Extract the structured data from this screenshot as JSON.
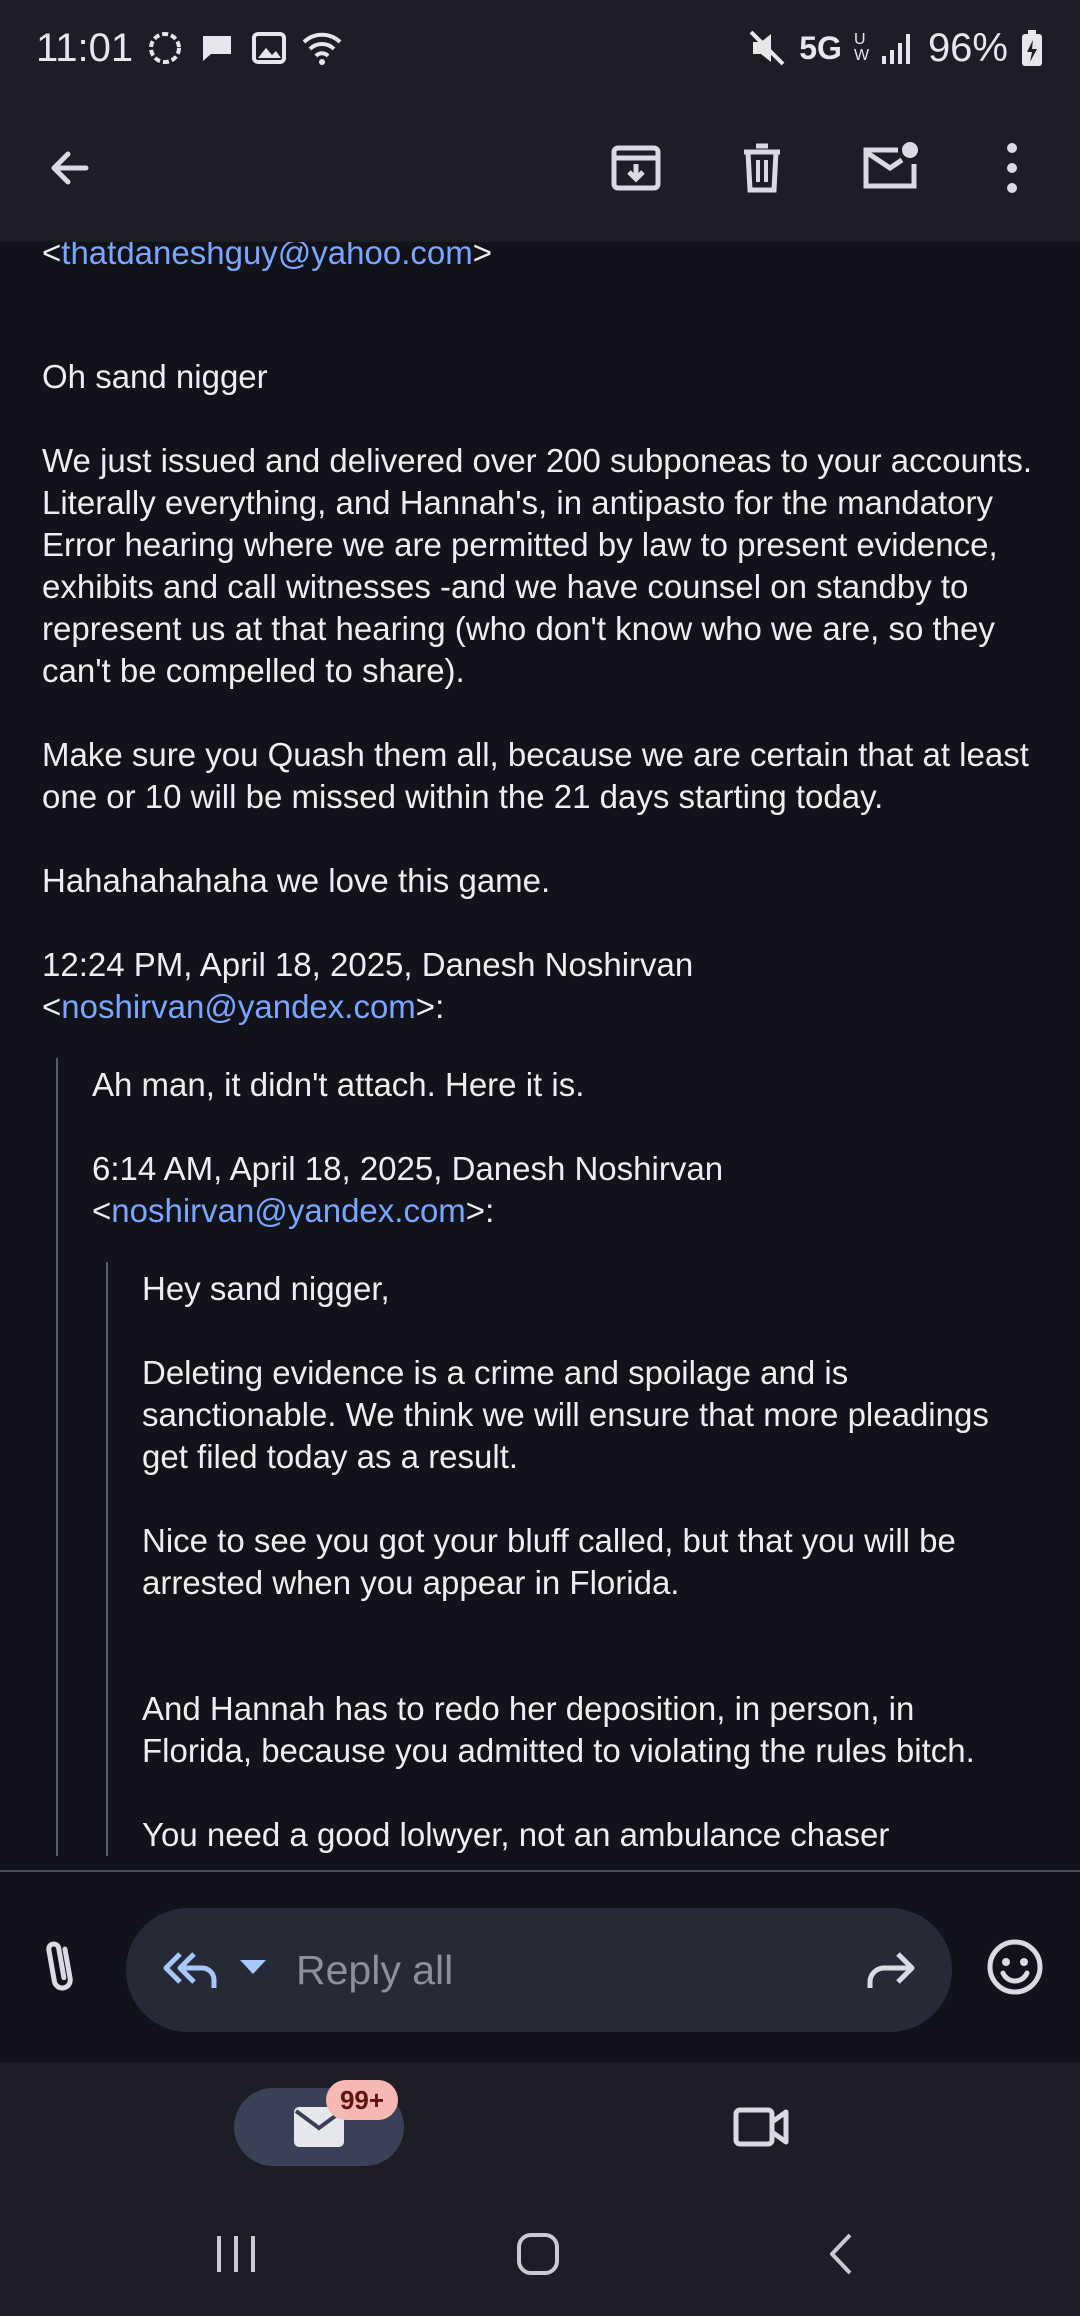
{
  "status_bar": {
    "time": "11:01",
    "network": "5G",
    "network_sub": "UW",
    "battery": "96%"
  },
  "email": {
    "from_prefix": "<",
    "from_address": "thatdaneshguy@yahoo.com",
    "from_suffix": ">",
    "greeting": "Oh sand nigger",
    "paragraph_1": "We just issued and delivered over 200 subponeas to your accounts. Literally everything, and Hannah's, in antipasto for the mandatory Error hearing where we are permitted by law to present evidence, exhibits and call witnesses -and we have counsel on standby to represent us at that hearing (who don't know who we are, so they can't be compelled to share).",
    "paragraph_2": "Make sure you Quash them all, because we are certain that at least one or 10 will be missed within the 21 days starting today.",
    "paragraph_3": "Hahahahahaha we love this game.",
    "quote_header_1": "12:24 PM, April 18, 2025, Danesh Noshirvan",
    "quote_addr_1_prefix": "<",
    "quote_addr_1": "noshirvan@yandex.com",
    "quote_addr_1_suffix": ">:",
    "quote_1_line": "Ah man, it didn't attach. Here it is.",
    "quote_header_2": "6:14 AM, April 18, 2025, Danesh Noshirvan",
    "quote_addr_2_prefix": "<",
    "quote_addr_2": "noshirvan@yandex.com",
    "quote_addr_2_suffix": ">:",
    "quote_2_greeting": "Hey sand nigger,",
    "quote_2_p1": "Deleting evidence is a crime and spoilage and is sanctionable. We think we will ensure that more pleadings get filed today as a result.",
    "quote_2_p2": "Nice to see you got your bluff called, but that you will be arrested when you appear in Florida.",
    "quote_2_p3": "And Hannah has to redo her deposition, in person, in Florida, because you admitted to violating the rules bitch.",
    "quote_2_p4": "You need a good lolwyer, not an ambulance chaser"
  },
  "reply_bar": {
    "placeholder": "Reply all"
  },
  "bottom_nav": {
    "mail_badge": "99+"
  },
  "colors": {
    "background": "#12131a",
    "bars": "#1d1e25",
    "link": "#7aa6ff",
    "accent": "#a8c7fa",
    "badge": "#f6b8b3"
  }
}
